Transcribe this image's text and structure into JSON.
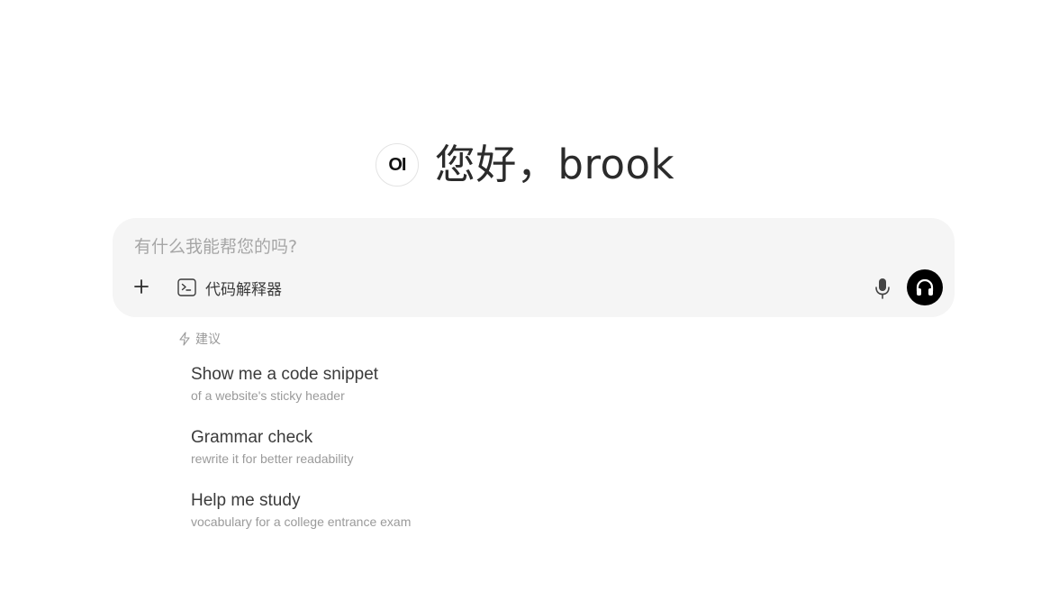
{
  "greeting": {
    "logo_text": "OI",
    "text": "您好，brook"
  },
  "composer": {
    "placeholder": "有什么我能帮您的吗?",
    "value": "",
    "tool_label": "代码解释器",
    "icons": {
      "add": "plus-icon",
      "tool": "terminal-icon",
      "mic": "microphone-icon",
      "voice": "headphones-icon"
    }
  },
  "suggestions": {
    "header": "建议",
    "header_icon": "lightning-icon",
    "items": [
      {
        "title": "Show me a code snippet",
        "subtitle": "of a website's sticky header"
      },
      {
        "title": "Grammar check",
        "subtitle": "rewrite it for better readability"
      },
      {
        "title": "Help me study",
        "subtitle": "vocabulary for a college entrance exam"
      }
    ]
  },
  "colors": {
    "composer_bg": "#f5f5f5",
    "voice_button_bg": "#000000",
    "muted_text": "#9a9a9a"
  }
}
